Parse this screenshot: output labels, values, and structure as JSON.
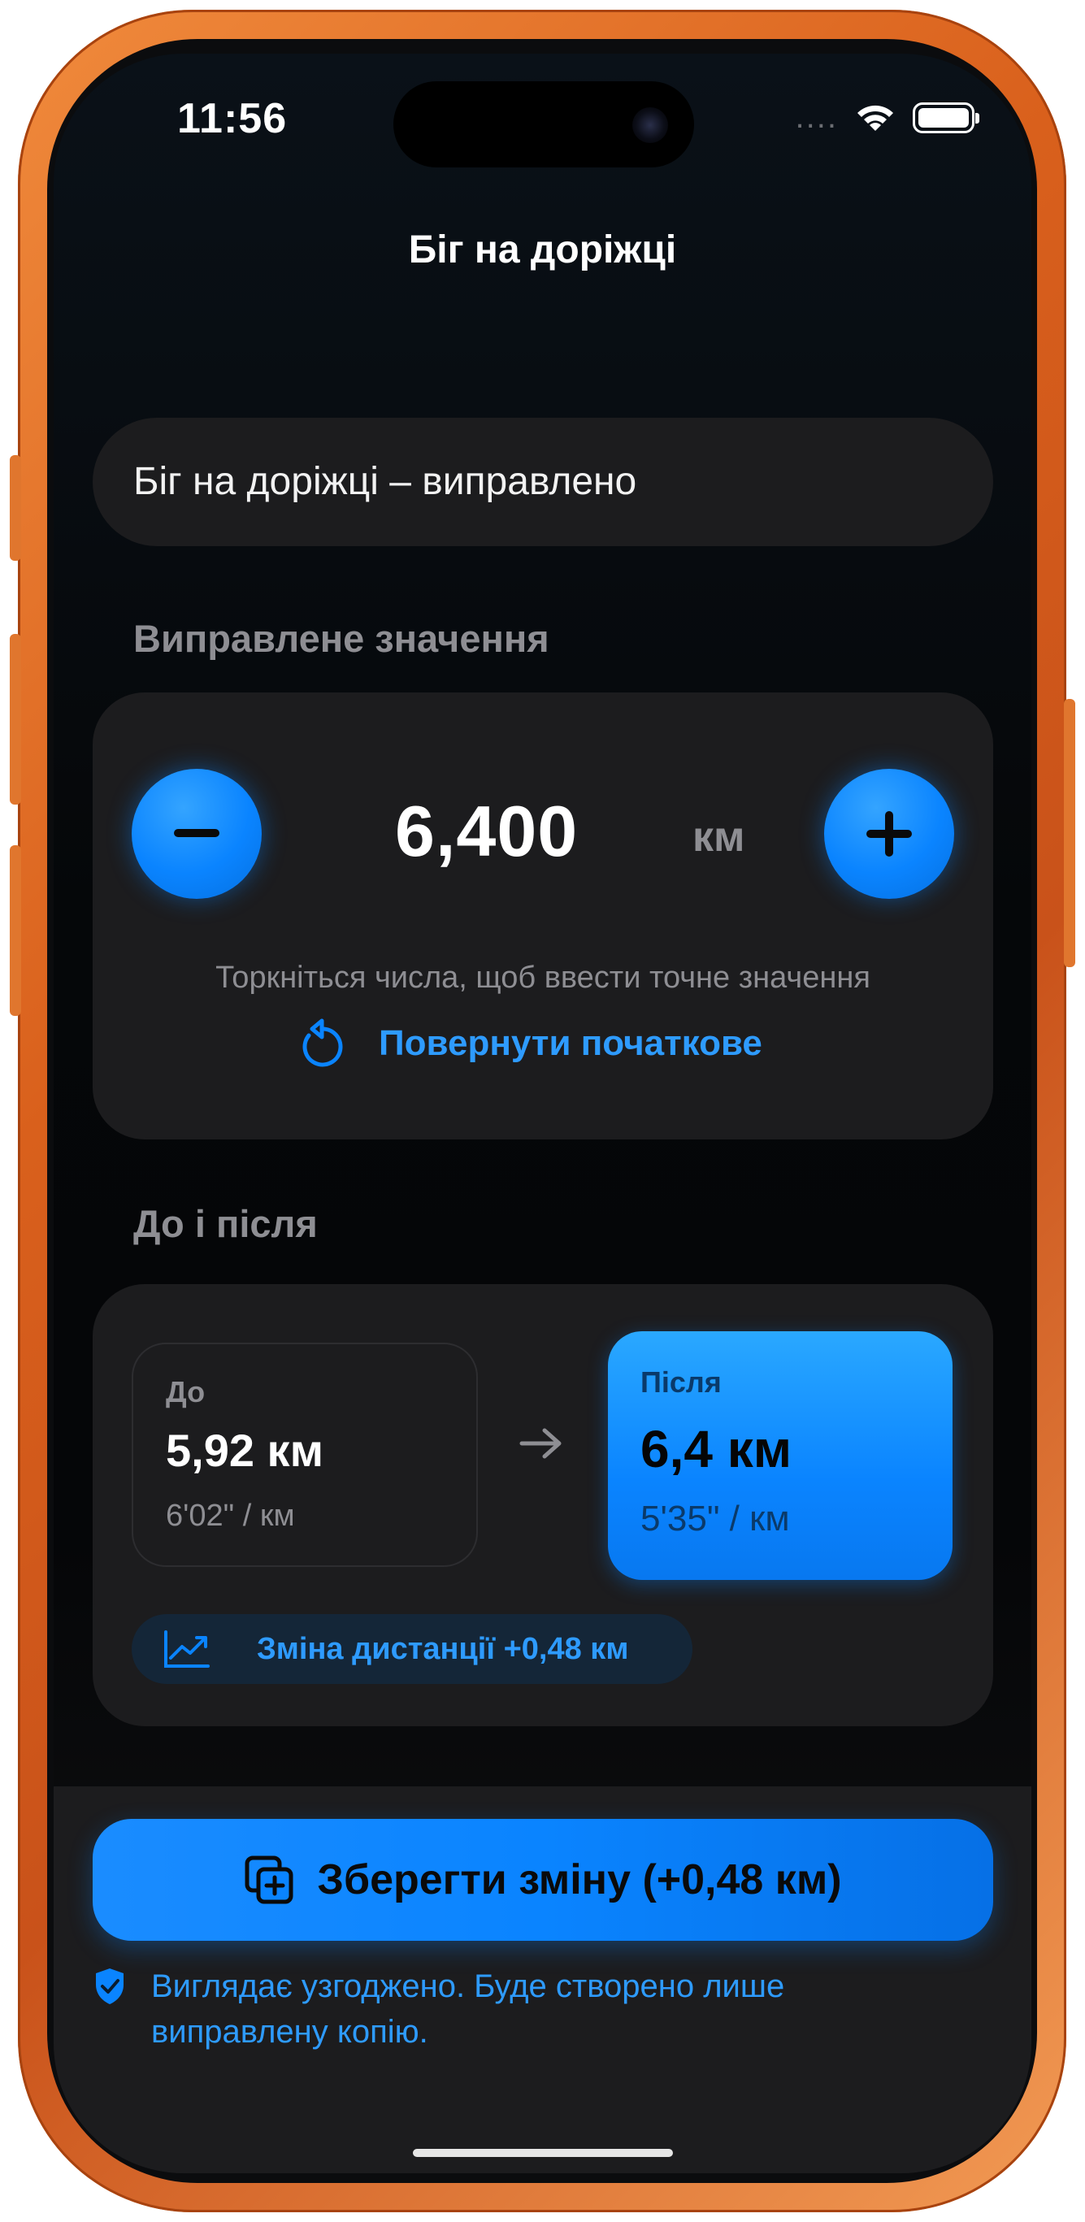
{
  "status": {
    "time": "11:56",
    "dots": "....",
    "wifi_icon": "wifi-icon",
    "battery_icon": "battery-icon"
  },
  "nav": {
    "title": "Біг на доріжці"
  },
  "name_field": {
    "value": "Біг на доріжці – виправлено"
  },
  "corrected": {
    "section_label": "Виправлене значення",
    "value": "6,400",
    "unit": "км",
    "hint": "Торкніться числа, щоб ввести точне значення",
    "reset_label": "Повернути початкове"
  },
  "comparison": {
    "section_label": "До і після",
    "before": {
      "caption": "До",
      "distance": "5,92 км",
      "pace": "6'02\" / км"
    },
    "after": {
      "caption": "Після",
      "distance": "6,4 км",
      "pace": "5'35\" / км"
    },
    "change_label": "Зміна дистанції +0,48 км"
  },
  "footer": {
    "save_label": "Зберегти зміну (+0,48 км)",
    "note": "Виглядає узгоджено. Буде створено лише виправлену копію."
  },
  "colors": {
    "accent": "#0a84ff",
    "frame": "#e0762e",
    "card": "#1c1c1e"
  }
}
